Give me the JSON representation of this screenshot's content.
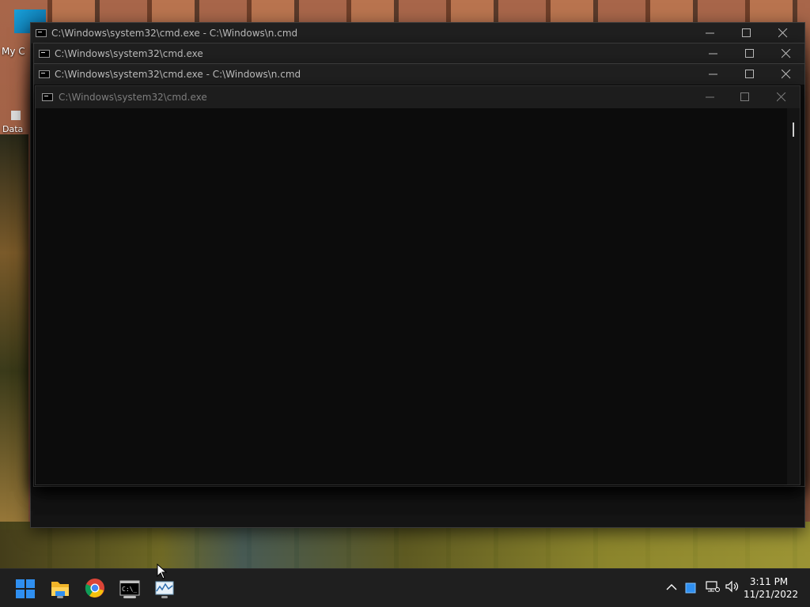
{
  "desktop": {
    "icons": [
      {
        "label": "My C"
      },
      {
        "label": "Data"
      }
    ]
  },
  "windows": [
    {
      "title": "C:\\Windows\\system32\\cmd.exe - C:\\Windows\\n.cmd"
    },
    {
      "title": "C:\\Windows\\system32\\cmd.exe"
    },
    {
      "title": "C:\\Windows\\system32\\cmd.exe - C:\\Windows\\n.cmd"
    },
    {
      "title": "C:\\Windows\\system32\\cmd.exe"
    }
  ],
  "taskbar": {
    "apps": [
      {
        "name": "start-icon"
      },
      {
        "name": "file-explorer-icon"
      },
      {
        "name": "chrome-icon"
      },
      {
        "name": "command-prompt-icon"
      },
      {
        "name": "performance-monitor-icon"
      }
    ],
    "clock": {
      "time": "3:11 PM",
      "date": "11/21/2022"
    }
  },
  "colors": {
    "window_bg": "#202020",
    "console_bg": "#0c0c0c",
    "taskbar_bg": "#1f1f1f",
    "accent": "#2f8ff0"
  }
}
